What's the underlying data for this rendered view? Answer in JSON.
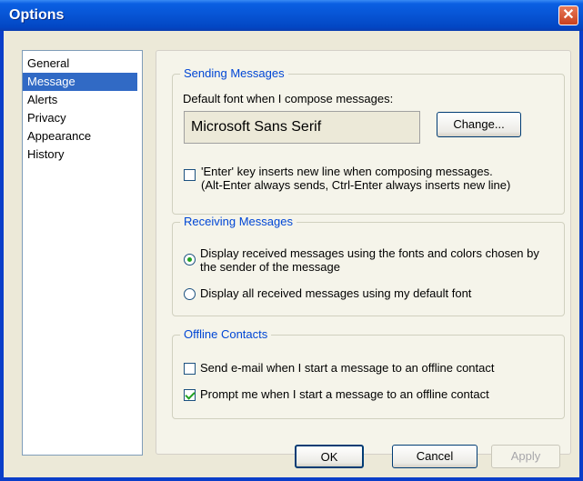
{
  "window": {
    "title": "Options"
  },
  "nav": {
    "items": [
      "General",
      "Message",
      "Alerts",
      "Privacy",
      "Appearance",
      "History"
    ],
    "selected": "Message"
  },
  "sending": {
    "legend": "Sending Messages",
    "default_font_label": "Default font when I compose messages:",
    "font_value": "Microsoft Sans Serif",
    "change_label": "Change...",
    "enter_line1": "'Enter' key inserts new line when composing messages.",
    "enter_line2": "(Alt-Enter always sends, Ctrl-Enter always inserts new line)",
    "enter_checked": false
  },
  "receiving": {
    "legend": "Receiving Messages",
    "option1_line1": "Display received messages using the fonts and colors chosen by",
    "option1_line2": "the sender of the message",
    "option2": "Display all received messages using my default font",
    "selected_option": 1
  },
  "offline": {
    "legend": "Offline Contacts",
    "email_label": "Send e-mail when I start a message to an offline contact",
    "email_checked": false,
    "prompt_label": "Prompt me when I start a message to an offline contact",
    "prompt_checked": true
  },
  "footer": {
    "ok": "OK",
    "cancel": "Cancel",
    "apply": "Apply"
  },
  "colors": {
    "title_bar": "#0a5fe3",
    "selection": "#316ac5",
    "legend_text": "#0046d5",
    "check_green": "#21a121",
    "close_button": "#c9401d"
  }
}
